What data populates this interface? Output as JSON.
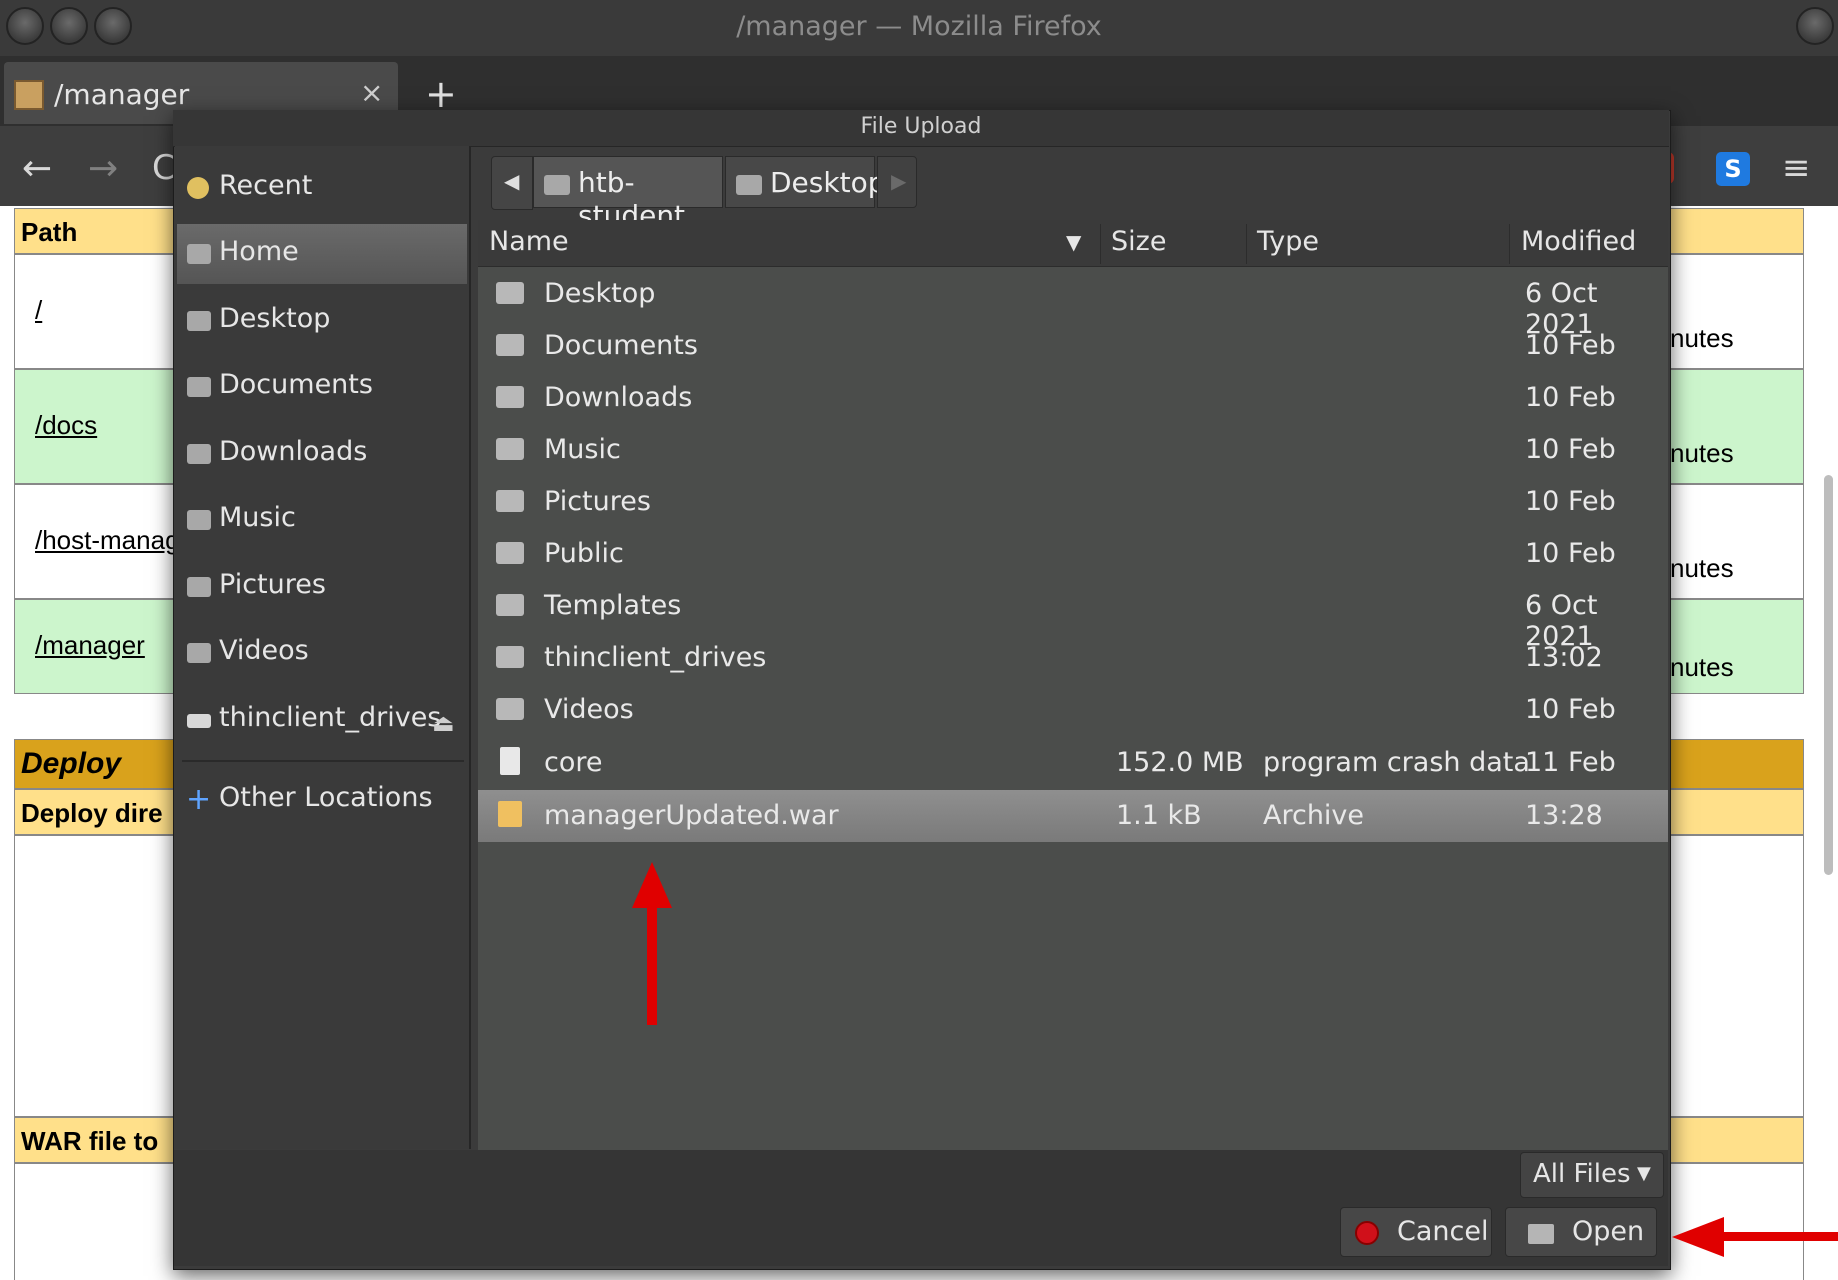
{
  "window": {
    "title": "/manager — Mozilla Firefox"
  },
  "browser": {
    "tab_title": "/manager",
    "tab_close": "×",
    "new_tab": "+",
    "back": "←",
    "forward": "→",
    "reload": "C",
    "extension_label": "S",
    "menu": "≡"
  },
  "page": {
    "path_header": "Path",
    "rows": [
      {
        "path": "/",
        "status": "nutes"
      },
      {
        "path": "/docs",
        "status": "nutes"
      },
      {
        "path": "/host-manag",
        "status": "nutes"
      },
      {
        "path": "/manager",
        "status": "nutes"
      }
    ],
    "deploy_header": "Deploy",
    "deploy_dir_label": "Deploy dire",
    "war_label": "WAR file to"
  },
  "dialog": {
    "title": "File Upload",
    "sidebar": [
      {
        "label": "Recent",
        "icon": "recent-icon"
      },
      {
        "label": "Home",
        "icon": "home-icon",
        "active": true
      },
      {
        "label": "Desktop",
        "icon": "desktop-folder-icon"
      },
      {
        "label": "Documents",
        "icon": "documents-folder-icon"
      },
      {
        "label": "Downloads",
        "icon": "downloads-folder-icon"
      },
      {
        "label": "Music",
        "icon": "music-folder-icon"
      },
      {
        "label": "Pictures",
        "icon": "pictures-folder-icon"
      },
      {
        "label": "Videos",
        "icon": "videos-folder-icon"
      },
      {
        "label": "thinclient_drives",
        "icon": "drive-icon"
      }
    ],
    "other_locations": "Other Locations",
    "path_bar": {
      "back": "◀",
      "crumbs": [
        "htb-student",
        "Desktop"
      ],
      "forward": "▶"
    },
    "columns": {
      "name": "Name",
      "size": "Size",
      "type": "Type",
      "modified": "Modified"
    },
    "files": [
      {
        "name": "Desktop",
        "size": "",
        "type": "",
        "modified": "6 Oct 2021",
        "kind": "folder"
      },
      {
        "name": "Documents",
        "size": "",
        "type": "",
        "modified": "10 Feb",
        "kind": "folder"
      },
      {
        "name": "Downloads",
        "size": "",
        "type": "",
        "modified": "10 Feb",
        "kind": "folder"
      },
      {
        "name": "Music",
        "size": "",
        "type": "",
        "modified": "10 Feb",
        "kind": "folder"
      },
      {
        "name": "Pictures",
        "size": "",
        "type": "",
        "modified": "10 Feb",
        "kind": "folder"
      },
      {
        "name": "Public",
        "size": "",
        "type": "",
        "modified": "10 Feb",
        "kind": "folder"
      },
      {
        "name": "Templates",
        "size": "",
        "type": "",
        "modified": "6 Oct 2021",
        "kind": "folder"
      },
      {
        "name": "thinclient_drives",
        "size": "",
        "type": "",
        "modified": "13:02",
        "kind": "folder"
      },
      {
        "name": "Videos",
        "size": "",
        "type": "",
        "modified": "10 Feb",
        "kind": "folder"
      },
      {
        "name": "core",
        "size": "152.0 MB",
        "type": "program crash data",
        "modified": "11 Feb",
        "kind": "file"
      },
      {
        "name": "managerUpdated.war",
        "size": "1.1 kB",
        "type": "Archive",
        "modified": "13:28",
        "kind": "archive",
        "selected": true
      }
    ],
    "filter": "All Files",
    "filter_arrow": "▼",
    "cancel": "Cancel",
    "open": "Open"
  },
  "colors": {
    "annotation_arrow": "#e00000",
    "selected_row": "#858585",
    "dialog_bg": "#3b3b3b"
  }
}
